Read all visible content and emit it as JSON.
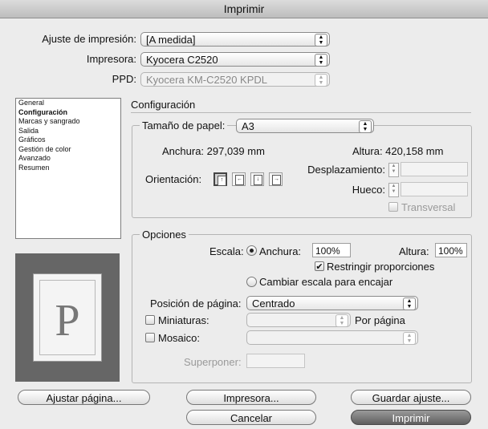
{
  "window": {
    "title": "Imprimir"
  },
  "top": {
    "preset_label": "Ajuste de impresión:",
    "preset_value": "[A medida]",
    "printer_label": "Impresora:",
    "printer_value": "Kyocera C2520",
    "ppd_label": "PPD:",
    "ppd_value": "Kyocera KM-C2520 KPDL"
  },
  "sidebar": {
    "items": [
      {
        "label": "General",
        "selected": false
      },
      {
        "label": "Configuración",
        "selected": true
      },
      {
        "label": "Marcas y sangrado",
        "selected": false
      },
      {
        "label": "Salida",
        "selected": false
      },
      {
        "label": "Gráficos",
        "selected": false
      },
      {
        "label": "Gestión de color",
        "selected": false
      },
      {
        "label": "Avanzado",
        "selected": false
      },
      {
        "label": "Resumen",
        "selected": false
      }
    ]
  },
  "preview": {
    "letter": "P"
  },
  "config": {
    "title": "Configuración",
    "paper_size_label": "Tamaño de papel:",
    "paper_size_value": "A3",
    "width_label": "Anchura: 297,039 mm",
    "height_label": "Altura: 420,158 mm",
    "orientation_label": "Orientación:",
    "offset_label": "Desplazamiento:",
    "gap_label": "Hueco:",
    "transverse_label": "Transversal"
  },
  "options": {
    "title": "Opciones",
    "scale_label": "Escala:",
    "scale_width_label": "Anchura:",
    "scale_width_value": "100%",
    "scale_height_label": "Altura:",
    "scale_height_value": "100%",
    "constrain_label": "Restringir proporciones",
    "constrain_checked": true,
    "fit_label": "Cambiar escala para encajar",
    "page_position_label": "Posición de página:",
    "page_position_value": "Centrado",
    "thumbnails_label": "Miniaturas:",
    "per_page_label": "Por página",
    "tile_label": "Mosaico:",
    "overlap_label": "Superponer:"
  },
  "buttons": {
    "page_setup": "Ajustar página...",
    "printer": "Impresora...",
    "save_preset": "Guardar ajuste...",
    "cancel": "Cancelar",
    "print": "Imprimir"
  }
}
